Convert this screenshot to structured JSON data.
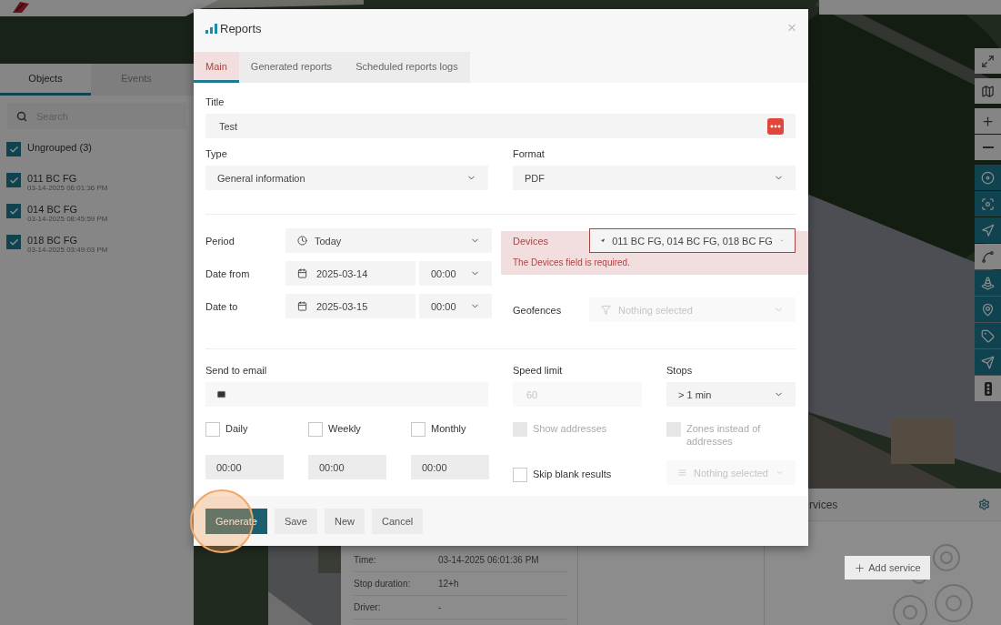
{
  "left_panel": {
    "tabs": [
      {
        "label": "Objects",
        "selected": true
      },
      {
        "label": "Events",
        "selected": false
      }
    ],
    "search": {
      "placeholder": "Search"
    },
    "groups": [
      {
        "label": "Ungrouped (3)",
        "checked": true,
        "children": [
          {
            "name": "011 BC FG",
            "time": "03-14-2025 06:01:36 PM",
            "checked": true
          },
          {
            "name": "014 BC FG",
            "time": "03-14-2025 08:45:59 PM",
            "checked": true
          },
          {
            "name": "018 BC FG",
            "time": "03-14-2025 03:49:03 PM",
            "checked": true
          }
        ]
      }
    ]
  },
  "map_tools": [
    {
      "kind": "fullscreen",
      "active": false
    },
    {
      "kind": "map",
      "active": false
    },
    {
      "kind": "zoom-in",
      "active": false
    },
    {
      "kind": "zoom-out",
      "active": false
    },
    {
      "kind": "target",
      "active": true
    },
    {
      "kind": "focus",
      "active": true
    },
    {
      "kind": "navigate",
      "active": true
    },
    {
      "kind": "route",
      "active": false
    },
    {
      "kind": "road",
      "active": true
    },
    {
      "kind": "pin",
      "active": true
    },
    {
      "kind": "tag",
      "active": true
    },
    {
      "kind": "send",
      "active": true
    },
    {
      "kind": "traffic",
      "active": false
    }
  ],
  "details": {
    "rows": [
      {
        "label": "Time:",
        "value": "03-14-2025 06:01:36 PM"
      },
      {
        "label": "Stop duration:",
        "value": "12+h"
      },
      {
        "label": "Driver:",
        "value": "-"
      }
    ]
  },
  "services": {
    "title": "rvices",
    "add_button": "Add service"
  },
  "dialog": {
    "title": "Reports",
    "close": "×",
    "tabs": [
      {
        "label": "Main",
        "selected": true
      },
      {
        "label": "Generated reports",
        "selected": false
      },
      {
        "label": "Scheduled reports logs",
        "selected": false
      }
    ],
    "title_field": {
      "label": "Title",
      "value": "Test"
    },
    "type": {
      "label": "Type",
      "value": "General information"
    },
    "format": {
      "label": "Format",
      "value": "PDF"
    },
    "period": {
      "label": "Period",
      "value": "Today"
    },
    "date_from": {
      "label": "Date from",
      "date": "2025-03-14",
      "time": "00:00"
    },
    "date_to": {
      "label": "Date to",
      "date": "2025-03-15",
      "time": "00:00"
    },
    "devices": {
      "label": "Devices",
      "value": "011 BC FG, 014 BC FG, 018 BC FG",
      "error": "The Devices field is required."
    },
    "geofences": {
      "label": "Geofences",
      "placeholder": "Nothing selected",
      "disabled": true
    },
    "send_to_email": {
      "label": "Send to email"
    },
    "speed_limit": {
      "label": "Speed limit",
      "placeholder": "60",
      "disabled": true
    },
    "stops": {
      "label": "Stops",
      "value": "> 1 min"
    },
    "schedule": [
      {
        "label": "Daily",
        "checked": false,
        "time": "00:00"
      },
      {
        "label": "Weekly",
        "checked": false,
        "time": "00:00"
      },
      {
        "label": "Monthly",
        "checked": false,
        "time": "00:00"
      }
    ],
    "options": [
      {
        "label": "Show addresses",
        "checked": false,
        "disabled": true
      },
      {
        "label": "Zones instead of addresses",
        "checked": false,
        "disabled": true
      },
      {
        "label": "Skip blank results",
        "checked": false,
        "disabled": false
      }
    ],
    "zones_select": {
      "placeholder": "Nothing selected",
      "disabled": true
    },
    "buttons": [
      {
        "label": "Generate",
        "kind": "primary",
        "highlighted": true
      },
      {
        "label": "Save",
        "kind": "default",
        "highlighted": false
      },
      {
        "label": "New",
        "kind": "default",
        "highlighted": false
      },
      {
        "label": "Cancel",
        "kind": "default",
        "highlighted": false
      }
    ]
  }
}
